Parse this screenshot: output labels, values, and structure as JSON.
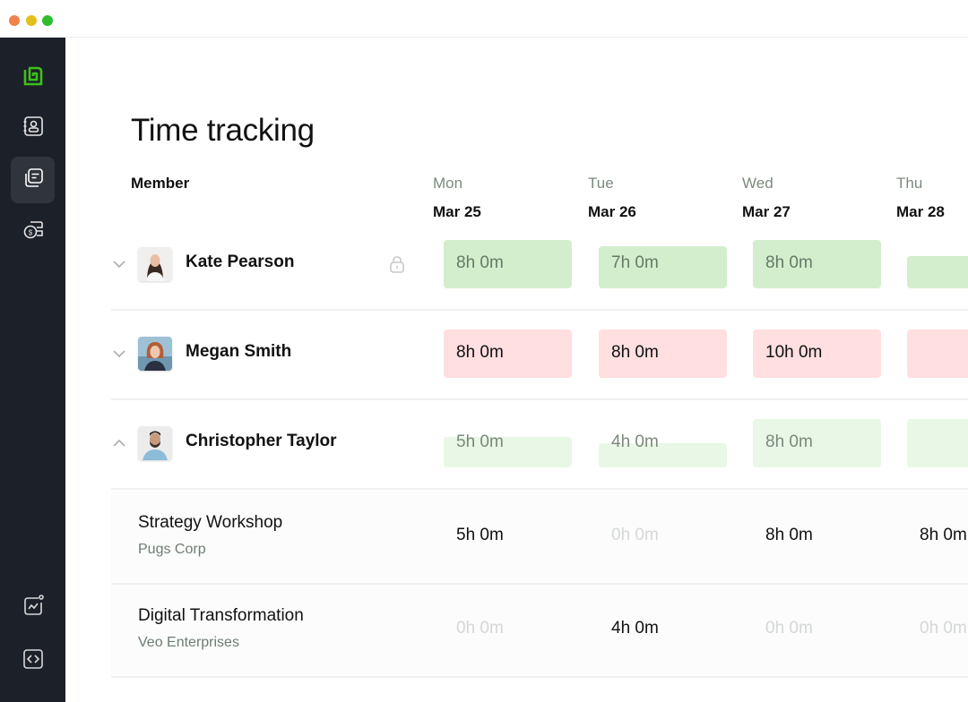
{
  "window": {
    "controls": [
      {
        "name": "close",
        "color": "#f0824c"
      },
      {
        "name": "minimize",
        "color": "#e2c01b"
      },
      {
        "name": "maximize",
        "color": "#2ebd2e"
      }
    ]
  },
  "sidebar": {
    "brand_color": "#3cc21b",
    "items": [
      {
        "icon": "logo-icon",
        "label": "Home"
      },
      {
        "icon": "contacts-icon",
        "label": "Members"
      },
      {
        "icon": "timesheet-icon",
        "label": "Time tracking",
        "active": true
      },
      {
        "icon": "billing-icon",
        "label": "Billing"
      },
      {
        "icon": "analytics-icon",
        "label": "Reports"
      },
      {
        "icon": "code-icon",
        "label": "Developer"
      }
    ]
  },
  "page": {
    "title": "Time tracking",
    "member_header": "Member"
  },
  "days": [
    {
      "name": "Mon",
      "date": "Mar 25"
    },
    {
      "name": "Tue",
      "date": "Mar 26"
    },
    {
      "name": "Wed",
      "date": "Mar 27"
    },
    {
      "name": "Thu",
      "date": "Mar 28"
    }
  ],
  "colors": {
    "under": "#d3eecd",
    "over": "#ffdfe0",
    "faded": "#e9f7e6",
    "text_under": "#667a68",
    "text_over": "#111111",
    "text_faded": "#7b897c",
    "text_zero": "#d4d8d4"
  },
  "members": [
    {
      "name": "Kate Pearson",
      "expanded": false,
      "locked": true,
      "status": "under",
      "entries": [
        {
          "label": "8h 0m",
          "fill": 1.0
        },
        {
          "label": "7h 0m",
          "fill": 0.875
        },
        {
          "label": "8h 0m",
          "fill": 1.0
        },
        {
          "label": "",
          "fill": 0.67
        }
      ]
    },
    {
      "name": "Megan Smith",
      "expanded": false,
      "locked": false,
      "status": "over",
      "entries": [
        {
          "label": "8h 0m",
          "fill": 1.0
        },
        {
          "label": "8h 0m",
          "fill": 1.0
        },
        {
          "label": "10h 0m",
          "fill": 1.0
        },
        {
          "label": "",
          "fill": 1.0
        }
      ]
    },
    {
      "name": "Christopher Taylor",
      "expanded": true,
      "locked": false,
      "status": "faded",
      "entries": [
        {
          "label": "5h 0m",
          "fill": 0.625
        },
        {
          "label": "4h 0m",
          "fill": 0.5
        },
        {
          "label": "8h 0m",
          "fill": 1.0
        },
        {
          "label": "",
          "fill": 1.0
        }
      ],
      "projects": [
        {
          "name": "Strategy Workshop",
          "client": "Pugs Corp",
          "values": [
            "5h 0m",
            "0h 0m",
            "8h 0m",
            "8h 0m"
          ]
        },
        {
          "name": "Digital Transformation",
          "client": "Veo Enterprises",
          "values": [
            "0h 0m",
            "4h 0m",
            "0h 0m",
            "0h 0m"
          ]
        }
      ]
    }
  ]
}
